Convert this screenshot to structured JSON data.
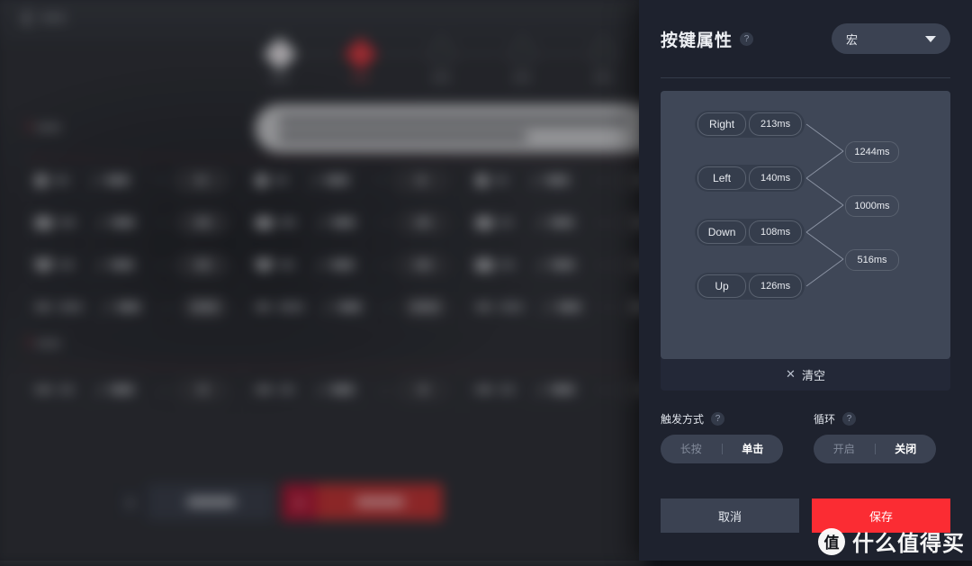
{
  "panel": {
    "title": "按键属性",
    "help_icon": "question-mark-icon",
    "mode_select": {
      "value": "宏",
      "caret_icon": "chevron-down-icon",
      "options": [
        "宏"
      ]
    }
  },
  "macro": {
    "steps": [
      {
        "key": "Right",
        "duration": "213ms"
      },
      {
        "key": "Left",
        "duration": "140ms"
      },
      {
        "key": "Down",
        "duration": "108ms"
      },
      {
        "key": "Up",
        "duration": "126ms"
      }
    ],
    "intervals": [
      {
        "value": "1244ms"
      },
      {
        "value": "1000ms"
      },
      {
        "value": "516ms"
      }
    ],
    "clear": {
      "icon": "close-icon",
      "symbol": "✕",
      "label": "清空"
    }
  },
  "options": [
    {
      "label": "触发方式",
      "help_icon": "question-mark-icon",
      "choices": [
        "长按",
        "单击"
      ],
      "selected": "单击"
    },
    {
      "label": "循环",
      "help_icon": "question-mark-icon",
      "choices": [
        "开启",
        "关闭"
      ],
      "selected": "关闭"
    }
  ],
  "footer": {
    "cancel_label": "取消",
    "save_label": "保存"
  },
  "watermark": {
    "logo_char": "值",
    "text": "什么值得买"
  },
  "colors": {
    "panel_background": "#1e222e",
    "card_background": "#3f4757",
    "accent_red": "#fb2c33",
    "chip_background": "#353d4c",
    "control_background": "#3b4252",
    "text_primary": "#e8ebf0",
    "text_muted": "#838b9b"
  }
}
